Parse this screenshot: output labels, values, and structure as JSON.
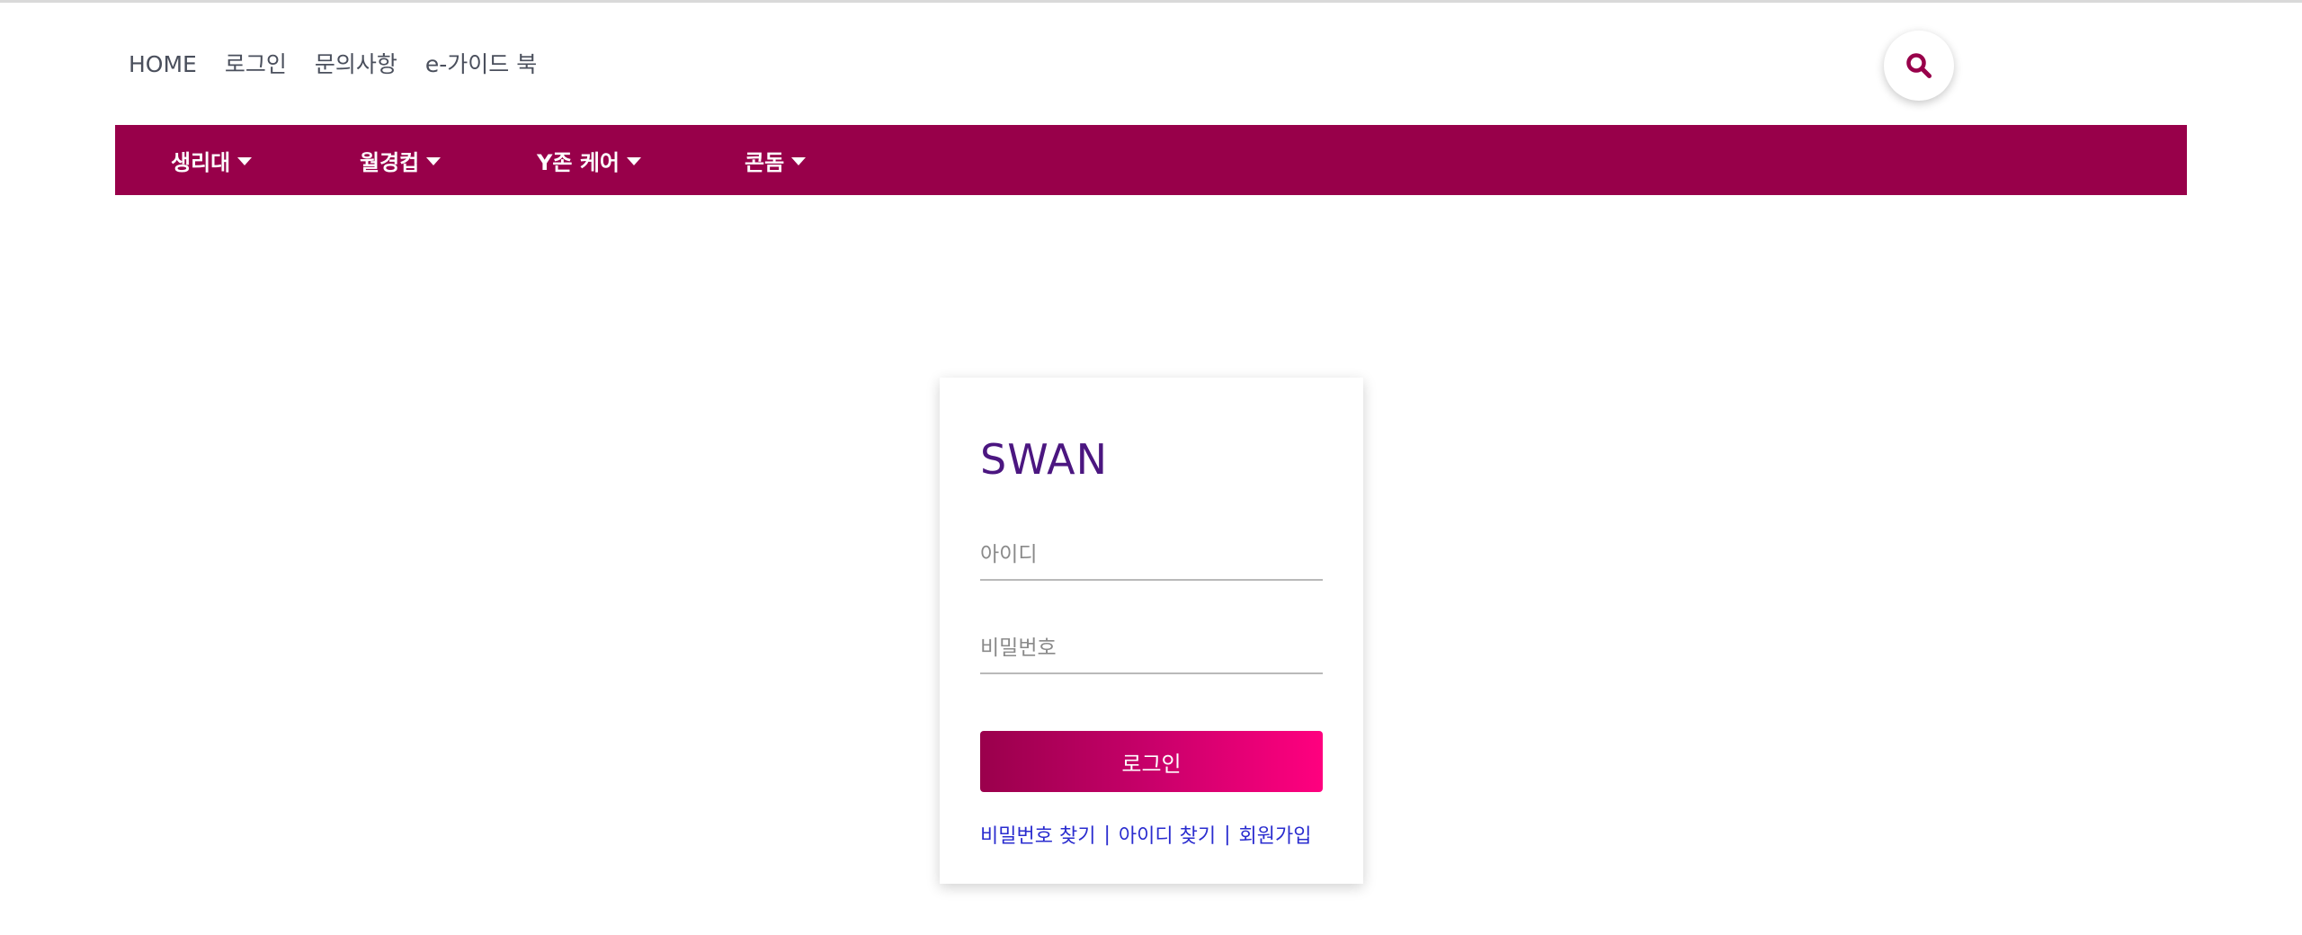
{
  "top_links": [
    "HOME",
    "로그인",
    "문의사항",
    "e-가이드 북"
  ],
  "search": {
    "icon": "search-icon"
  },
  "main_nav": [
    "생리대",
    "월경컵",
    "Y존 케어",
    "콘돔"
  ],
  "login": {
    "brand": "SWAN",
    "id_placeholder": "아이디",
    "pw_placeholder": "비밀번호",
    "submit_label": "로그인",
    "find_pw": "비밀번호 찾기",
    "find_id": "아이디 찾기",
    "signup": "회원가입",
    "separator": "|"
  },
  "colors": {
    "brand_magenta": "#98004a",
    "gradient_end": "#ff007f",
    "brand_text": "#4b1680",
    "link_blue": "#2a2ccf"
  }
}
